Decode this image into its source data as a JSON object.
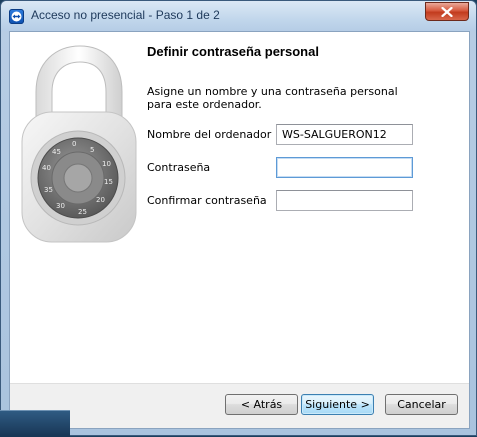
{
  "window": {
    "title": "Acceso no presencial - Paso 1 de 2",
    "app_icon": "teamviewer-icon",
    "close_icon": "close-icon"
  },
  "content": {
    "heading": "Definir contraseña personal",
    "description": "Asigne un nombre y una contraseña personal para este ordenador.",
    "illustration": "padlock-illustration"
  },
  "form": {
    "computer_name_label": "Nombre del ordenador",
    "computer_name_value": "WS-SALGUERON12",
    "password_label": "Contraseña",
    "password_value": "",
    "confirm_label": "Confirmar contraseña",
    "confirm_value": ""
  },
  "buttons": {
    "back": "< Atrás",
    "next": "Siguiente >",
    "cancel": "Cancelar"
  },
  "colors": {
    "accent": "#3c7fb1",
    "close": "#c23b1e"
  }
}
